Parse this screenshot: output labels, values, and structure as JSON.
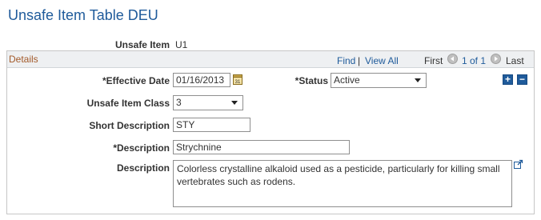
{
  "page": {
    "title": "Unsafe Item Table DEU"
  },
  "header": {
    "unsafe_item_label": "Unsafe Item",
    "unsafe_item_value": "U1"
  },
  "details": {
    "title": "Details",
    "nav": {
      "find": "Find",
      "sep": "|",
      "view_all": "View All",
      "first": "First",
      "range": "1 of 1",
      "last": "Last"
    },
    "effective_date_label": "*Effective Date",
    "effective_date_value": "01/16/2013",
    "status_label": "*Status",
    "status_value": "Active",
    "unsafe_item_class_label": "Unsafe Item Class",
    "unsafe_item_class_value": "3",
    "short_description_label": "Short Description",
    "short_description_value": "STY",
    "description_req_label": "*Description",
    "description_req_value": "Strychnine",
    "description_long_label": "Description",
    "description_long_value": "Colorless crystalline alkaloid used as a pesticide, particularly for killing small vertebrates such as rodens.",
    "add_row": "+",
    "delete_row": "−"
  },
  "icons": {
    "calendar": "calendar-icon",
    "expand": "expand-icon",
    "prev": "prev-arrow-icon",
    "next": "next-arrow-icon"
  },
  "colors": {
    "title": "#1f5b9b",
    "section_title": "#a35a2a",
    "link": "#1f5b9b"
  }
}
